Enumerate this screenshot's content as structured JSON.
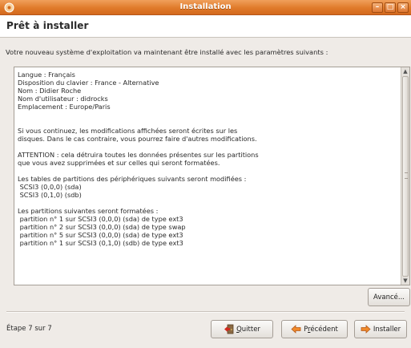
{
  "window": {
    "title": "Installation"
  },
  "page": {
    "heading": "Prêt à installer",
    "intro": "Votre nouveau système d'exploitation va maintenant être installé avec les paramètres suivants :"
  },
  "summary_lines": [
    "Langue : Français",
    "Disposition du clavier : France - Alternative",
    "Nom : Didier Roche",
    "Nom d'utilisateur : didrocks",
    "Emplacement : Europe/Paris",
    "",
    "",
    "Si vous continuez, les modifications affichées seront écrites sur les",
    "disques. Dans le cas contraire, vous pourrez faire d'autres modifications.",
    "",
    "ATTENTION : cela détruira toutes les données présentes sur les partitions",
    "que vous avez supprimées et sur celles qui seront formatées.",
    "",
    "Les tables de partitions des périphériques suivants seront modifiées :",
    " SCSI3 (0,0,0) (sda)",
    " SCSI3 (0,1,0) (sdb)",
    "",
    "Les partitions suivantes seront formatées :",
    " partition n° 1 sur SCSI3 (0,0,0) (sda) de type ext3",
    " partition n° 2 sur SCSI3 (0,0,0) (sda) de type swap",
    " partition n° 5 sur SCSI3 (0,0,0) (sda) de type ext3",
    " partition n° 1 sur SCSI3 (0,1,0) (sdb) de type ext3"
  ],
  "buttons": {
    "advanced": "Avancé...",
    "quit_prefix": "Q",
    "quit_rest": "uitter",
    "prev_a": "P",
    "prev_u": "r",
    "prev_b": "écédent",
    "install": "Installer"
  },
  "footer": {
    "step": "Étape 7 sur 7"
  },
  "colors": {
    "titlebar": "#e07a2a",
    "accent": "#d3691d"
  },
  "icons": {
    "app": "ubuntu-installer-icon",
    "minimize": "minimize-icon",
    "maximize": "maximize-icon",
    "close": "close-icon",
    "quit": "quit-icon",
    "previous": "arrow-left-icon",
    "install": "arrow-right-icon"
  }
}
